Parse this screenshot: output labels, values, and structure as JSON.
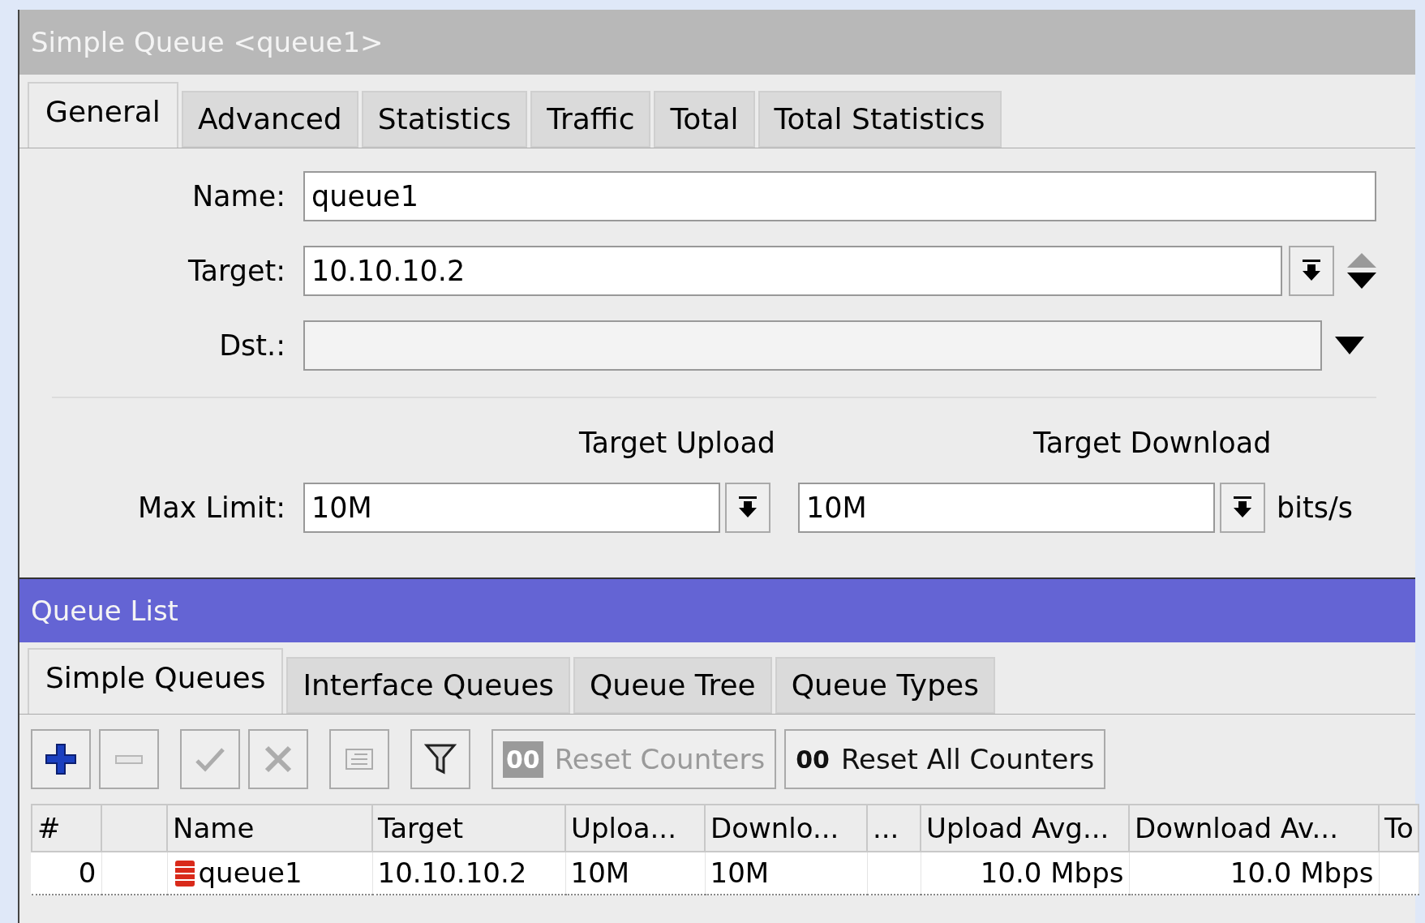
{
  "editor": {
    "title": "Simple Queue <queue1>",
    "tabs": [
      {
        "label": "General",
        "selected": true
      },
      {
        "label": "Advanced",
        "selected": false
      },
      {
        "label": "Statistics",
        "selected": false
      },
      {
        "label": "Traffic",
        "selected": false
      },
      {
        "label": "Total",
        "selected": false
      },
      {
        "label": "Total Statistics",
        "selected": false
      }
    ],
    "name": {
      "label": "Name:",
      "value": "queue1"
    },
    "target": {
      "label": "Target:",
      "value": "10.10.10.2"
    },
    "dst": {
      "label": "Dst.:"
    },
    "limit_headers": [
      "Target Upload",
      "Target Download"
    ],
    "max_limit": {
      "label": "Max Limit:",
      "upload": "10M",
      "download": "10M",
      "unit": "bits/s"
    }
  },
  "queue_list": {
    "title": "Queue List",
    "tabs": [
      {
        "label": "Simple Queues",
        "selected": true
      },
      {
        "label": "Interface Queues",
        "selected": false
      },
      {
        "label": "Queue Tree",
        "selected": false
      },
      {
        "label": "Queue Types",
        "selected": false
      }
    ],
    "toolbar": [
      {
        "kind": "add",
        "disabled": false
      },
      {
        "kind": "remove",
        "disabled": true
      },
      {
        "kind": "enable",
        "disabled": true
      },
      {
        "kind": "disable",
        "disabled": true
      },
      {
        "kind": "comment",
        "disabled": true
      },
      {
        "kind": "filter",
        "disabled": false
      },
      {
        "kind": "text",
        "label": "Reset Counters",
        "badge": "00",
        "disabled": true
      },
      {
        "kind": "text",
        "label": "Reset All Counters",
        "badge": "00",
        "disabled": false
      }
    ],
    "columns": [
      "#",
      "",
      "Name",
      "Target",
      "Uploa...",
      "Downlo...",
      "...",
      "Upload Avg...",
      "Download Av...",
      "To"
    ],
    "rows": [
      {
        "cells": [
          "0",
          "",
          "queue1",
          "10.10.10.2",
          "10M",
          "10M",
          "",
          "10.0 Mbps",
          "10.0 Mbps",
          ""
        ]
      }
    ]
  }
}
